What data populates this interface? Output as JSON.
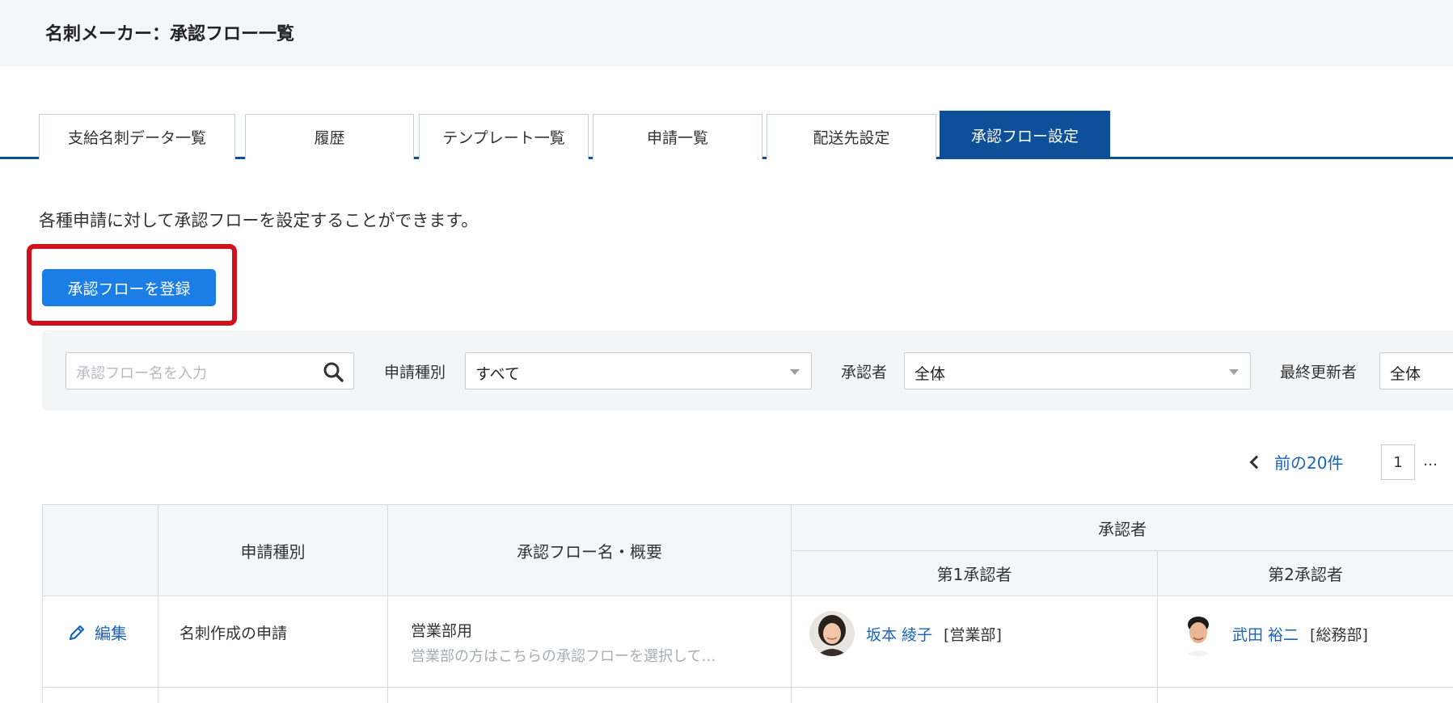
{
  "page": {
    "title": "名刺メーカー：承認フロー一覧"
  },
  "tabs": [
    {
      "label": "支給名刺データ一覧",
      "active": false
    },
    {
      "label": "履歴",
      "active": false
    },
    {
      "label": "テンプレート一覧",
      "active": false
    },
    {
      "label": "申請一覧",
      "active": false
    },
    {
      "label": "配送先設定",
      "active": false
    },
    {
      "label": "承認フロー設定",
      "active": true
    }
  ],
  "description": "各種申請に対して承認フローを設定することができます。",
  "register_button": {
    "label": "承認フローを登録"
  },
  "filters": {
    "search_placeholder": "承認フロー名を入力",
    "request_type_label": "申請種別",
    "request_type_value": "すべて",
    "approver_label": "承認者",
    "approver_value": "全体",
    "last_updated_by_label": "最終更新者",
    "last_updated_by_value": "全体"
  },
  "pagination": {
    "prev_label": "前の20件",
    "current_page": "1",
    "ellipsis": "…"
  },
  "table": {
    "headers": {
      "request_type": "申請種別",
      "flow_name": "承認フロー名・概要",
      "approvers": "承認者",
      "first_approver": "第1承認者",
      "second_approver": "第2承認者"
    },
    "rows": [
      {
        "edit_label": "編集",
        "request_type": "名刺作成の申請",
        "flow_name": "営業部用",
        "flow_summary": "営業部の方はこちらの承認フローを選択して…",
        "first_approver": {
          "name": "坂本 綾子",
          "dept": "[営業部]"
        },
        "second_approver": {
          "name": "武田 裕二",
          "dept": "[総務部]"
        }
      }
    ]
  },
  "colors": {
    "primary": "#0d4f98",
    "button": "#1a7ee6",
    "link": "#1a63b8",
    "highlight": "#d0121b"
  }
}
